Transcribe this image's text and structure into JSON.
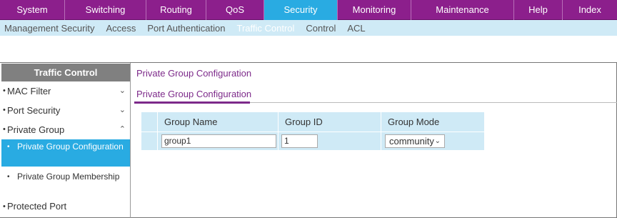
{
  "top_menu": [
    {
      "label": "System",
      "name": "tab-system"
    },
    {
      "label": "Switching",
      "name": "tab-switching"
    },
    {
      "label": "Routing",
      "name": "tab-routing"
    },
    {
      "label": "QoS",
      "name": "tab-qos"
    },
    {
      "label": "Security",
      "name": "tab-security",
      "active": true
    },
    {
      "label": "Monitoring",
      "name": "tab-monitoring"
    },
    {
      "label": "Maintenance",
      "name": "tab-maintenance"
    },
    {
      "label": "Help",
      "name": "tab-help"
    },
    {
      "label": "Index",
      "name": "tab-index"
    }
  ],
  "sub_menu": [
    {
      "label": "Management Security",
      "name": "submenu-management-security"
    },
    {
      "label": "Access",
      "name": "submenu-access"
    },
    {
      "label": "Port Authentication",
      "name": "submenu-port-authentication"
    },
    {
      "label": "Traffic Control",
      "name": "submenu-traffic-control",
      "active": true
    },
    {
      "label": "Control",
      "name": "submenu-control"
    },
    {
      "label": "ACL",
      "name": "submenu-acl"
    }
  ],
  "sidebar": {
    "header": "Traffic Control",
    "items": [
      {
        "label": "MAC Filter",
        "chevron": "down"
      },
      {
        "label": "Port Security",
        "chevron": "down"
      },
      {
        "label": "Private Group",
        "chevron": "up"
      }
    ],
    "sub_items": [
      {
        "label": "Private Group Configuration",
        "active": true
      },
      {
        "label": "Private Group Membership"
      }
    ],
    "last_item": {
      "label": "Protected Port"
    }
  },
  "main": {
    "title": "Private Group Configuration",
    "subtab": "Private Group Configuration"
  },
  "table": {
    "headers": [
      "Group Name",
      "Group ID",
      "Group Mode"
    ],
    "row": {
      "group_name": "group1",
      "group_id": "1",
      "group_mode": "community"
    }
  },
  "colors": {
    "menu_purple": "#8c1f8c",
    "active_blue": "#29abe2",
    "submenu_bg": "#cfeaf6",
    "title_purple": "#7d2a8a"
  }
}
